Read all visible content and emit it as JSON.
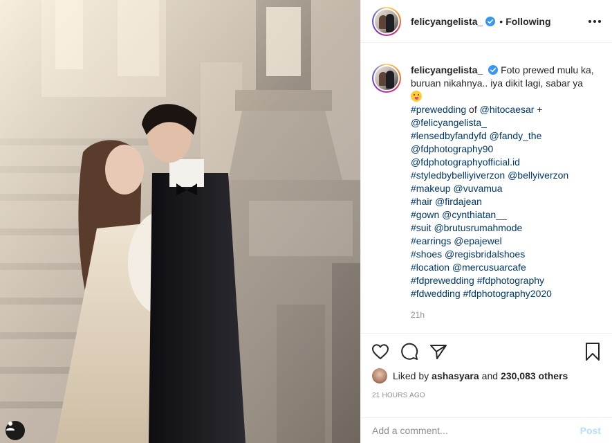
{
  "post": {
    "username": "felicyangelista_",
    "verified": true,
    "follow_status": "Following",
    "dot": "•"
  },
  "caption": {
    "username": "felicyangelista_",
    "text": "Foto prewed mulu ka, buruan nikahnya.. iya dikit lagi, sabar ya",
    "line1_a": "#prewedding",
    "line1_b": " of ",
    "line1_c": "@hitocaesar",
    "line1_d": " +",
    "tags": [
      "@felicyangelista_",
      "#lensedbyfandyfd @fandy_the",
      "@fdphotography90",
      "@fdphotographyofficial.id",
      "#styledbybelliyiverzon @bellyiverzon",
      "#makeup @vuvamua",
      "#hair @firdajean",
      "#gown @cynthiatan__",
      "#suit @brutusrumahmode",
      "#earrings @epajewel",
      "#shoes @regisbridalshoes",
      "#location @mercusuarcafe",
      "#fdprewedding #fdphotography",
      "#fdwedding #fdphotography2020"
    ],
    "age": "21h"
  },
  "likes": {
    "prefix": "Liked by",
    "liker": "ashasyara",
    "middle": "and",
    "others": "230,083 others"
  },
  "timestamp": "21 HOURS AGO",
  "comment": {
    "placeholder": "Add a comment...",
    "post_label": "Post"
  },
  "icons": {
    "verified": "verified-badge-icon",
    "more": "more-options-icon",
    "like": "heart-icon",
    "comment": "comment-bubble-icon",
    "share": "paper-plane-icon",
    "save": "bookmark-icon",
    "tags": "user-tag-icon"
  },
  "colors": {
    "verified_blue": "#3897f0",
    "link_blue": "#00376b",
    "post_disabled": "#b2dffc",
    "muted": "#8e8e8e"
  }
}
